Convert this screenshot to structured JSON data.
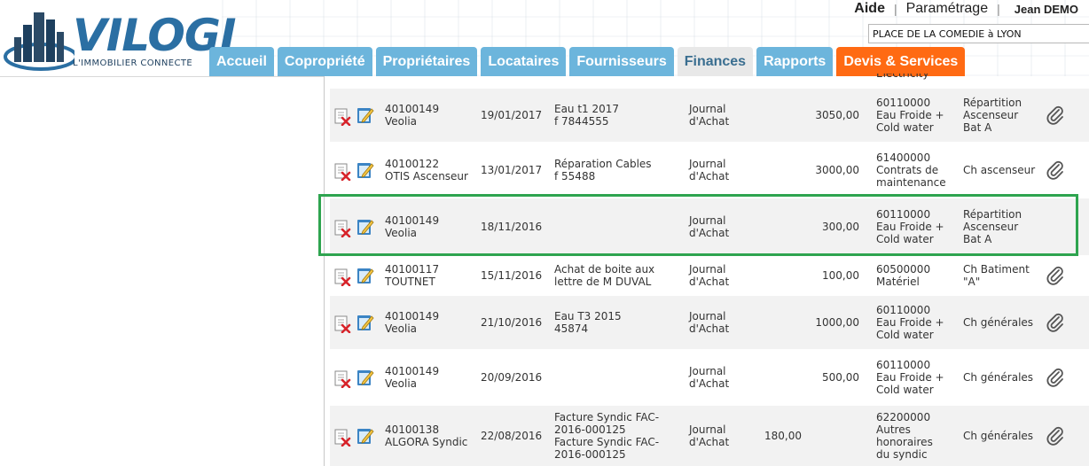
{
  "logo": {
    "text": "VILOGI",
    "tagline": "L'IMMOBILIER CONNECTÉ"
  },
  "header": {
    "links": [
      "Aide",
      "Paramétrage"
    ],
    "user": "Jean DEMO",
    "location": "PLACE DE LA COMEDIE à LYON"
  },
  "nav": {
    "tabs": [
      "Accueil",
      "Copropriété",
      "Propriétaires",
      "Locataires",
      "Fournisseurs",
      "Finances",
      "Rapports",
      "Devis & Services"
    ],
    "active": "Finances"
  },
  "colors": {
    "tab": "#6cb5dc",
    "tab_active": "#e8e8e8",
    "devis": "#ff6a13",
    "highlight": "#2ea44f"
  },
  "prev_row_text": "Electricity",
  "rows": [
    {
      "supplier": [
        "40100149",
        "Veolia"
      ],
      "date": "19/01/2017",
      "libelle": [
        "Eau t1 2017",
        "f 7844555"
      ],
      "journal": [
        "Journal",
        "d'Achat"
      ],
      "debit": "",
      "montant": "3050,00",
      "compte": [
        "60110000",
        "Eau Froide +",
        "Cold water"
      ],
      "repartition": [
        "Répartition",
        "Ascenseur",
        "Bat A"
      ],
      "attachment": true
    },
    {
      "supplier": [
        "40100122",
        "OTIS Ascenseur"
      ],
      "date": "13/01/2017",
      "libelle": [
        "Réparation Cables",
        "f 55488"
      ],
      "journal": [
        "Journal",
        "d'Achat"
      ],
      "debit": "",
      "montant": "3000,00",
      "compte": [
        "61400000",
        "Contrats de",
        "maintenance"
      ],
      "repartition": [
        "Ch ascenseur"
      ],
      "attachment": true
    },
    {
      "supplier": [
        "40100149",
        "Veolia"
      ],
      "date": "18/11/2016",
      "libelle": [],
      "journal": [
        "Journal",
        "d'Achat"
      ],
      "debit": "",
      "montant": "300,00",
      "compte": [
        "60110000",
        "Eau Froide +",
        "Cold water"
      ],
      "repartition": [
        "Répartition",
        "Ascenseur",
        "Bat A"
      ],
      "attachment": false
    },
    {
      "supplier": [
        "40100117",
        "TOUTNET"
      ],
      "date": "15/11/2016",
      "libelle": [
        "Achat de boite aux",
        "lettre de M DUVAL"
      ],
      "journal": [
        "Journal",
        "d'Achat"
      ],
      "debit": "",
      "montant": "100,00",
      "compte": [
        "60500000",
        "Matériel"
      ],
      "repartition": [
        "Ch Batiment",
        "\"A\""
      ],
      "attachment": true
    },
    {
      "supplier": [
        "40100149",
        "Veolia"
      ],
      "date": "21/10/2016",
      "libelle": [
        "Eau T3 2015",
        "45874"
      ],
      "journal": [
        "Journal",
        "d'Achat"
      ],
      "debit": "",
      "montant": "1000,00",
      "compte": [
        "60110000",
        "Eau Froide +",
        "Cold water"
      ],
      "repartition": [
        "Ch générales"
      ],
      "attachment": true
    },
    {
      "supplier": [
        "40100149",
        "Veolia"
      ],
      "date": "20/09/2016",
      "libelle": [],
      "journal": [
        "Journal",
        "d'Achat"
      ],
      "debit": "",
      "montant": "500,00",
      "compte": [
        "60110000",
        "Eau Froide +",
        "Cold water"
      ],
      "repartition": [
        "Ch générales"
      ],
      "attachment": true
    },
    {
      "supplier": [
        "40100138",
        "ALGORA Syndic"
      ],
      "date": "22/08/2016",
      "libelle": [
        "Facture Syndic FAC-",
        "2016-000125",
        "Facture Syndic FAC-",
        "2016-000125"
      ],
      "journal": [
        "Journal",
        "d'Achat"
      ],
      "debit": "180,00",
      "montant": "",
      "compte": [
        "62200000",
        "Autres",
        "honoraires",
        "du syndic"
      ],
      "repartition": [
        "Ch générales"
      ],
      "attachment": true
    }
  ]
}
